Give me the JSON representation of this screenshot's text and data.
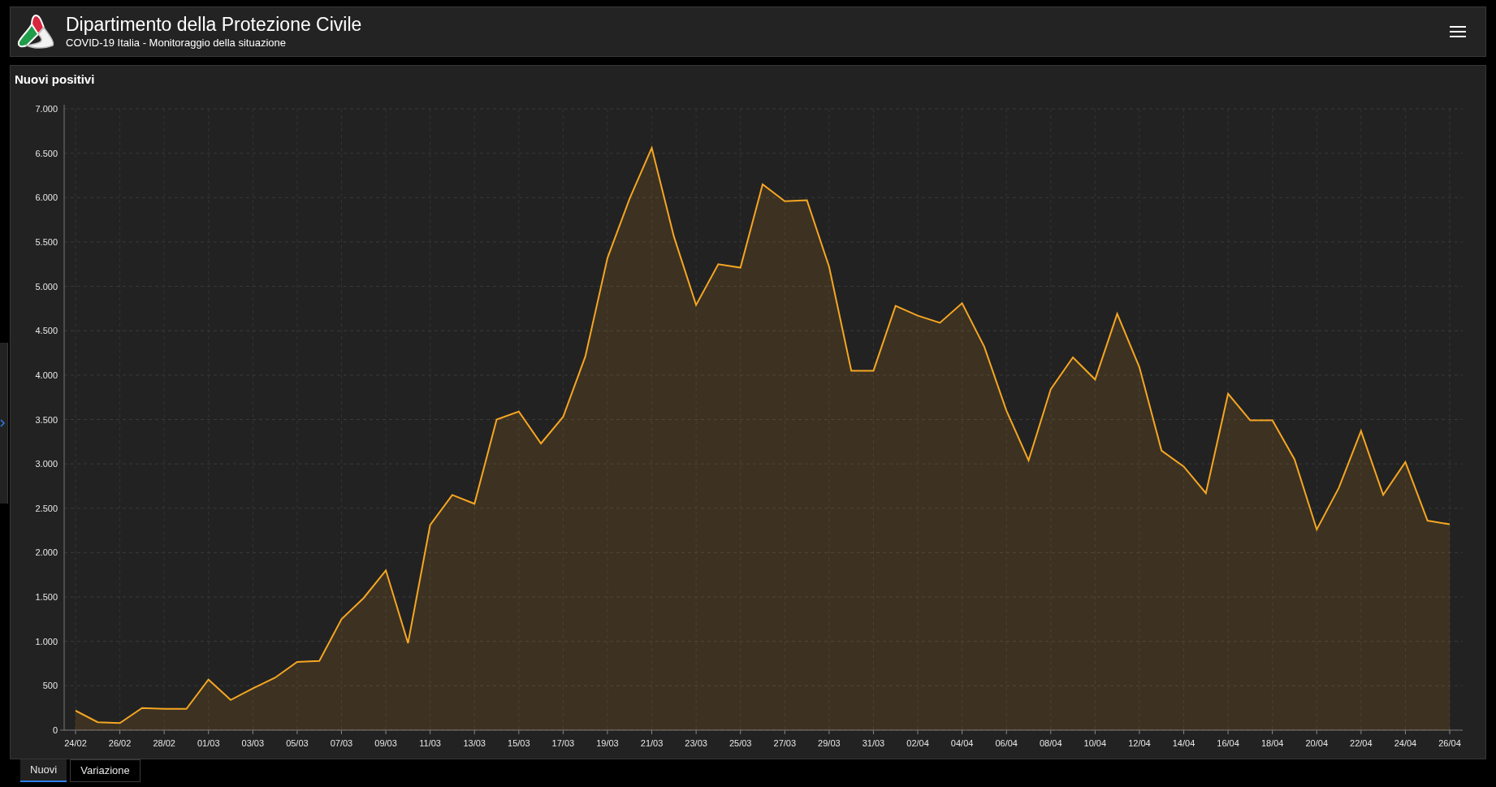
{
  "header": {
    "title": "Dipartimento della Protezione Civile",
    "subtitle": "COVID-19 Italia - Monitoraggio della situazione"
  },
  "panel": {
    "title": "Nuovi positivi",
    "chart_data": {
      "type": "area",
      "categories": [
        "24/02",
        null,
        "26/02",
        null,
        "28/02",
        null,
        "01/03",
        null,
        "03/03",
        null,
        "05/03",
        null,
        "07/03",
        null,
        "09/03",
        null,
        "11/03",
        null,
        "13/03",
        null,
        "15/03",
        null,
        "17/03",
        null,
        "19/03",
        null,
        "21/03",
        null,
        "23/03",
        null,
        "25/03",
        null,
        "27/03",
        null,
        "29/03",
        null,
        "31/03",
        null,
        "02/04",
        null,
        "04/04",
        null,
        "06/04",
        null,
        "08/04",
        null,
        "10/04",
        null,
        "12/04",
        null,
        "14/04",
        null,
        "16/04",
        null,
        "18/04",
        null,
        "20/04",
        null,
        "22/04",
        null,
        "24/04",
        null,
        "26/04"
      ],
      "series": [
        {
          "color": "#f5a623",
          "values": [
            220,
            90,
            80,
            250,
            240,
            240,
            570,
            340,
            470,
            590,
            770,
            780,
            1250,
            1490,
            1800,
            980,
            2310,
            2650,
            2550,
            3500,
            3590,
            3230,
            3530,
            4210,
            5320,
            5990,
            6560,
            5560,
            4790,
            5250,
            5210,
            6150,
            5960,
            5970,
            5220,
            4050,
            4050,
            4780,
            4670,
            4590,
            4810,
            4320,
            3600,
            3040,
            3840,
            4200,
            3950,
            4690,
            4090,
            3150,
            2970,
            2670,
            3790,
            3490,
            3490,
            3050,
            2260,
            2730,
            3370,
            2650,
            3020,
            2360,
            2320
          ]
        }
      ],
      "ylim": [
        0,
        7000
      ],
      "grid": true,
      "yticks": [
        {
          "value": 0,
          "label": "0"
        },
        {
          "value": 500,
          "label": "500"
        },
        {
          "value": 1000,
          "label": "1.000"
        },
        {
          "value": 1500,
          "label": "1.500"
        },
        {
          "value": 2000,
          "label": "2.000"
        },
        {
          "value": 2500,
          "label": "2.500"
        },
        {
          "value": 3000,
          "label": "3.000"
        },
        {
          "value": 3500,
          "label": "3.500"
        },
        {
          "value": 4000,
          "label": "4.000"
        },
        {
          "value": 4500,
          "label": "4.500"
        },
        {
          "value": 5000,
          "label": "5.000"
        },
        {
          "value": 5500,
          "label": "5.500"
        },
        {
          "value": 6000,
          "label": "6.000"
        },
        {
          "value": 6500,
          "label": "6.500"
        },
        {
          "value": 7000,
          "label": "7.000"
        }
      ]
    }
  },
  "tabs": [
    {
      "label": "Nuovi",
      "selected": true
    },
    {
      "label": "Variazione",
      "selected": false
    }
  ]
}
